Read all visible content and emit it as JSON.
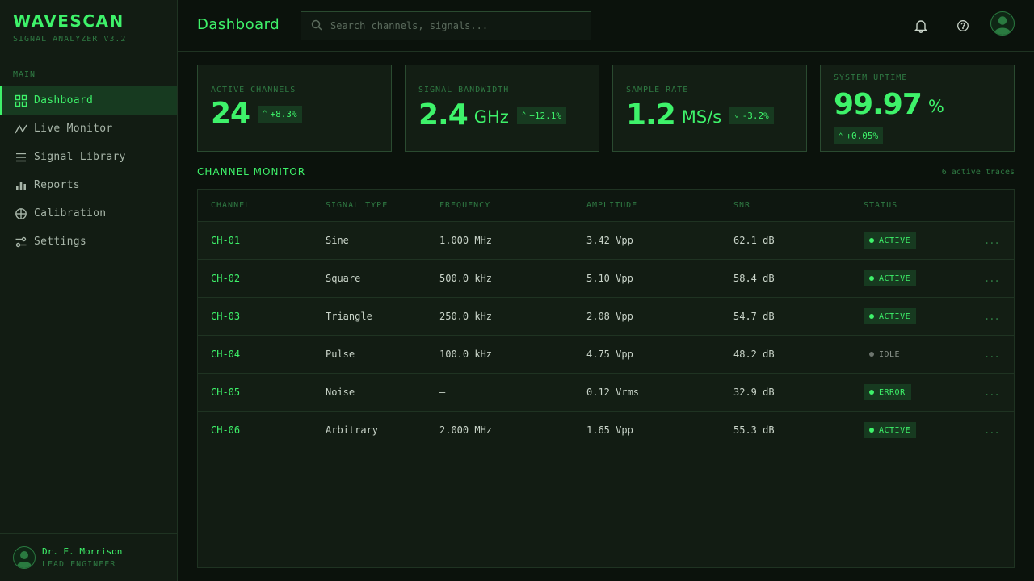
{
  "app": {
    "name": "WAVESCAN",
    "version": "SIGNAL ANALYZER V3.2"
  },
  "sidebar": {
    "section_label": "MAIN",
    "items": [
      {
        "label": "Dashboard",
        "icon": "grid-icon",
        "active": true
      },
      {
        "label": "Live Monitor",
        "icon": "pulse-icon",
        "active": false
      },
      {
        "label": "Signal Library",
        "icon": "list-icon",
        "active": false
      },
      {
        "label": "Reports",
        "icon": "bar-chart-icon",
        "active": false
      },
      {
        "label": "Calibration",
        "icon": "crosshair-icon",
        "active": false
      },
      {
        "label": "Settings",
        "icon": "sliders-icon",
        "active": false
      }
    ],
    "user": {
      "name": "Dr. E. Morrison",
      "role": "LEAD ENGINEER"
    }
  },
  "header": {
    "title": "Dashboard",
    "search_placeholder": "Search channels, signals..."
  },
  "stats": [
    {
      "label": "ACTIVE CHANNELS",
      "value": "24",
      "unit": "",
      "delta": "+8.3%",
      "direction": "up"
    },
    {
      "label": "SIGNAL BANDWIDTH",
      "value": "2.4",
      "unit": "GHz",
      "delta": "+12.1%",
      "direction": "up"
    },
    {
      "label": "SAMPLE RATE",
      "value": "1.2",
      "unit": "MS/s",
      "delta": "-3.2%",
      "direction": "down"
    },
    {
      "label": "SYSTEM UPTIME",
      "value": "99.97",
      "unit": "%",
      "delta": "+0.05%",
      "direction": "up"
    }
  ],
  "monitor": {
    "title": "CHANNEL MONITOR",
    "meta": "6 active traces",
    "columns": [
      "CHANNEL",
      "SIGNAL TYPE",
      "FREQUENCY",
      "AMPLITUDE",
      "SNR",
      "STATUS"
    ],
    "rows": [
      {
        "channel": "CH-01",
        "type": "Sine",
        "frequency": "1.000 MHz",
        "amplitude": "3.42 Vpp",
        "snr": "62.1 dB",
        "status": "ACTIVE"
      },
      {
        "channel": "CH-02",
        "type": "Square",
        "frequency": "500.0 kHz",
        "amplitude": "5.10 Vpp",
        "snr": "58.4 dB",
        "status": "ACTIVE"
      },
      {
        "channel": "CH-03",
        "type": "Triangle",
        "frequency": "250.0 kHz",
        "amplitude": "2.08 Vpp",
        "snr": "54.7 dB",
        "status": "ACTIVE"
      },
      {
        "channel": "CH-04",
        "type": "Pulse",
        "frequency": "100.0 kHz",
        "amplitude": "4.75 Vpp",
        "snr": "48.2 dB",
        "status": "IDLE"
      },
      {
        "channel": "CH-05",
        "type": "Noise",
        "frequency": "—",
        "amplitude": "0.12 Vrms",
        "snr": "32.9 dB",
        "status": "ERROR"
      },
      {
        "channel": "CH-06",
        "type": "Arbitrary",
        "frequency": "2.000 MHz",
        "amplitude": "1.65 Vpp",
        "snr": "55.3 dB",
        "status": "ACTIVE"
      }
    ],
    "more_label": "..."
  },
  "colors": {
    "accent": "#3ef26a",
    "muted": "#2f7a43",
    "panel": "#121c13",
    "border": "#1f3322"
  }
}
